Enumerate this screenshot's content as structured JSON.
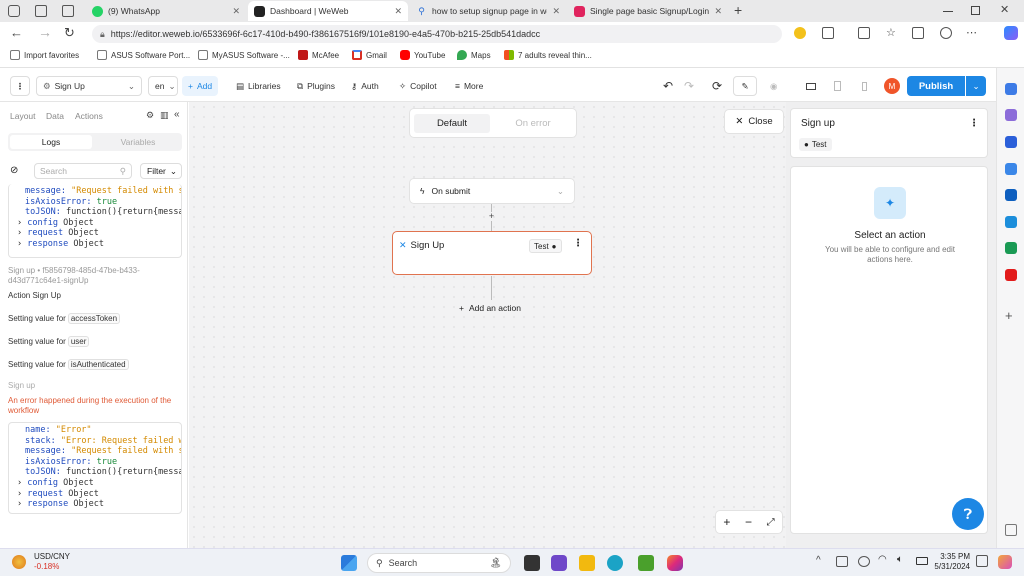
{
  "browser": {
    "tabs": [
      {
        "title": "(9) WhatsApp"
      },
      {
        "title": "Dashboard | WeWeb"
      },
      {
        "title": "how to setup signup page in we..."
      },
      {
        "title": "Single page basic Signup/Login ..."
      }
    ],
    "url": "https://editor.weweb.io/6533696f-6c17-410d-b490-f386167516f9/101e8190-e4a5-470b-b215-25db541dadcc",
    "bookmarks": [
      "Import favorites",
      "ASUS Software Port...",
      "MyASUS Software -...",
      "McAfee",
      "Gmail",
      "YouTube",
      "Maps",
      "7 adults reveal thin..."
    ]
  },
  "header": {
    "page_select": "Sign Up",
    "lang_select": "en",
    "add_label": "Add",
    "libraries_label": "Libraries",
    "plugins_label": "Plugins",
    "auth_label": "Auth",
    "copilot_label": "Copilot",
    "more_label": "More",
    "avatar_initial": "M",
    "publish_label": "Publish"
  },
  "left": {
    "tabs": [
      "Layout",
      "Data",
      "Actions"
    ],
    "subtabs": [
      "Logs",
      "Variables"
    ],
    "search_placeholder": "Search",
    "filter_label": "Filter",
    "block1": {
      "message_key": "message:",
      "message_val": "\"Request failed with statu",
      "axios_key": "isAxiosError:",
      "axios_val": "true",
      "tojson_key": "toJSON:",
      "tojson_val": "function(){return{message:",
      "config_key": "config",
      "config_val": "Object",
      "request_key": "request",
      "request_val": "Object",
      "response_key": "response",
      "response_val": "Object"
    },
    "workflow_id": "Sign up • f5856798-485d-47be-b433-d43d771c64e1-signUp",
    "action_label": "Action Sign Up",
    "setting_prefix": "Setting value for",
    "settings": [
      "accessToken",
      "user",
      "isAuthenticated"
    ],
    "signup_label": "Sign up",
    "error_message": "An error happened during the execution of the workflow",
    "block2": {
      "name_key": "name:",
      "name_val": "\"Error\"",
      "stack_key": "stack:",
      "stack_val": "\"Error: Request failed with sta",
      "message_key": "message:",
      "message_val": "\"Request failed with statu",
      "axios_key": "isAxiosError:",
      "axios_val": "true",
      "tojson_key": "toJSON:",
      "tojson_val": "function(){return{message:",
      "config_key": "config",
      "config_val": "Object",
      "request_key": "request",
      "request_val": "Object",
      "response_key": "response",
      "response_val": "Object"
    }
  },
  "canvas": {
    "toggle_default": "Default",
    "toggle_error": "On error",
    "close_label": "Close",
    "trigger_label": "On submit",
    "action_title": "Sign Up",
    "test_label": "Test",
    "add_action_label": "Add an action"
  },
  "right": {
    "title": "Sign up",
    "test_label": "Test",
    "select_title": "Select an action",
    "select_desc": "You will be able to configure and edit actions here."
  },
  "taskbar": {
    "ticker_name": "USD/CNY",
    "ticker_change": "-0.18%",
    "search_label": "Search",
    "time": "3:35 PM",
    "date": "5/31/2024"
  },
  "colors": {
    "accent": "#1d87e4",
    "error": "#e05a36",
    "avatar": "#f0552a"
  }
}
